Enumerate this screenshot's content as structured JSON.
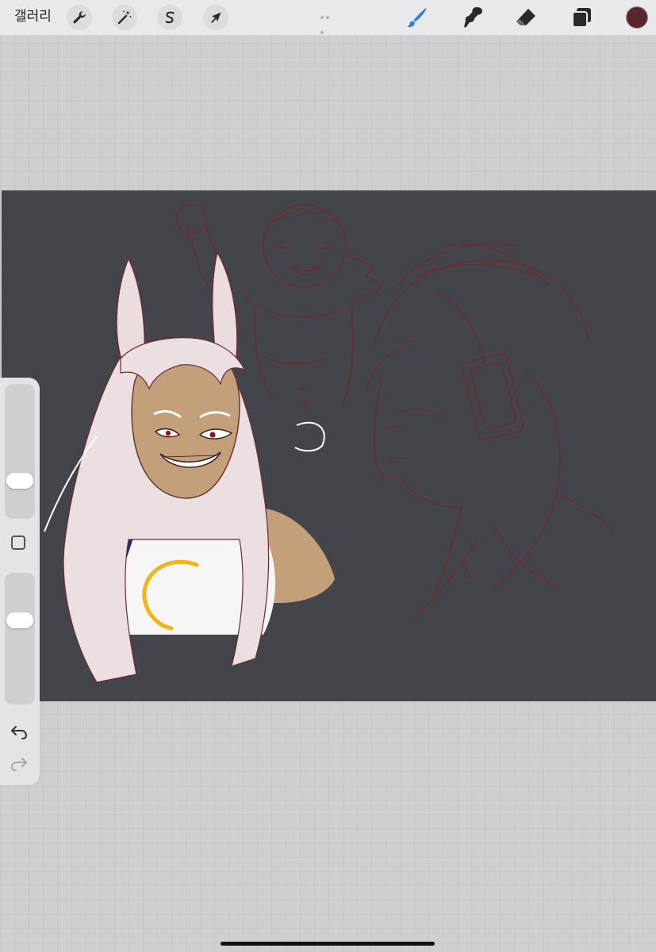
{
  "toolbar": {
    "gallery_label": "갤러리",
    "left_tools": [
      {
        "name": "actions",
        "icon": "wrench-icon"
      },
      {
        "name": "adjustments",
        "icon": "magic-wand-icon"
      },
      {
        "name": "selection",
        "icon": "selection-s-icon"
      },
      {
        "name": "transform",
        "icon": "arrow-cursor-icon"
      }
    ],
    "right_tools": [
      {
        "name": "brush",
        "icon": "brush-icon",
        "active": true
      },
      {
        "name": "smudge",
        "icon": "smudge-icon"
      },
      {
        "name": "eraser",
        "icon": "eraser-icon"
      },
      {
        "name": "layers",
        "icon": "layers-icon"
      }
    ],
    "current_color": "#5a2530",
    "active_color": "#2f7de1"
  },
  "sidebar": {
    "brush_size_level": 0.75,
    "opacity_level": 0.34,
    "modifier_icon": "square-modifier-icon",
    "undo_icon": "undo-icon",
    "redo_icon": "redo-icon"
  },
  "canvas": {
    "background_color": "#43454a",
    "sketch_color": "#6b2a2f"
  }
}
